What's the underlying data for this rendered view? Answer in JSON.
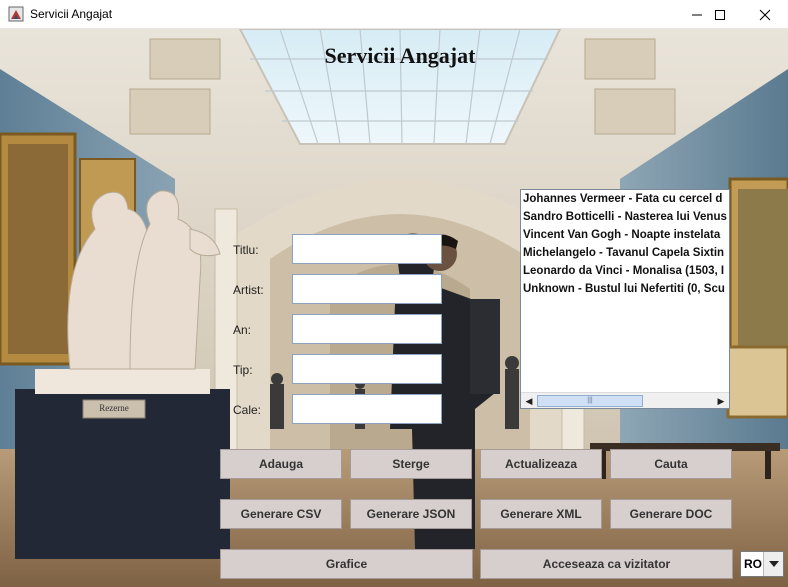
{
  "window": {
    "title": "Servicii Angajat"
  },
  "heading": "Servicii Angajat",
  "statue_plaque": "Rezerne",
  "form": {
    "titlu_label": "Titlu:",
    "artist_label": "Artist:",
    "an_label": "An:",
    "tip_label": "Tip:",
    "cale_label": "Cale:",
    "titlu_value": "",
    "artist_value": "",
    "an_value": "",
    "tip_value": "",
    "cale_value": ""
  },
  "list": {
    "items": [
      "Johannes Vermeer - Fata cu cercel d",
      "Sandro Botticelli - Nasterea lui Venus",
      "Vincent Van Gogh - Noapte instelata",
      "Michelangelo - Tavanul Capela Sixtin",
      "Leonardo da Vinci - Monalisa (1503, I",
      "Unknown - Bustul lui Nefertiti (0, Scu"
    ]
  },
  "buttons": {
    "adauga": "Adauga",
    "sterge": "Sterge",
    "actualizeaza": "Actualizeaza",
    "cauta": "Cauta",
    "csv": "Generare CSV",
    "json": "Generare JSON",
    "xml": "Generare XML",
    "doc": "Generare DOC",
    "grafice": "Grafice",
    "vizitator": "Acceseaza ca vizitator"
  },
  "language": {
    "selected": "RO"
  }
}
